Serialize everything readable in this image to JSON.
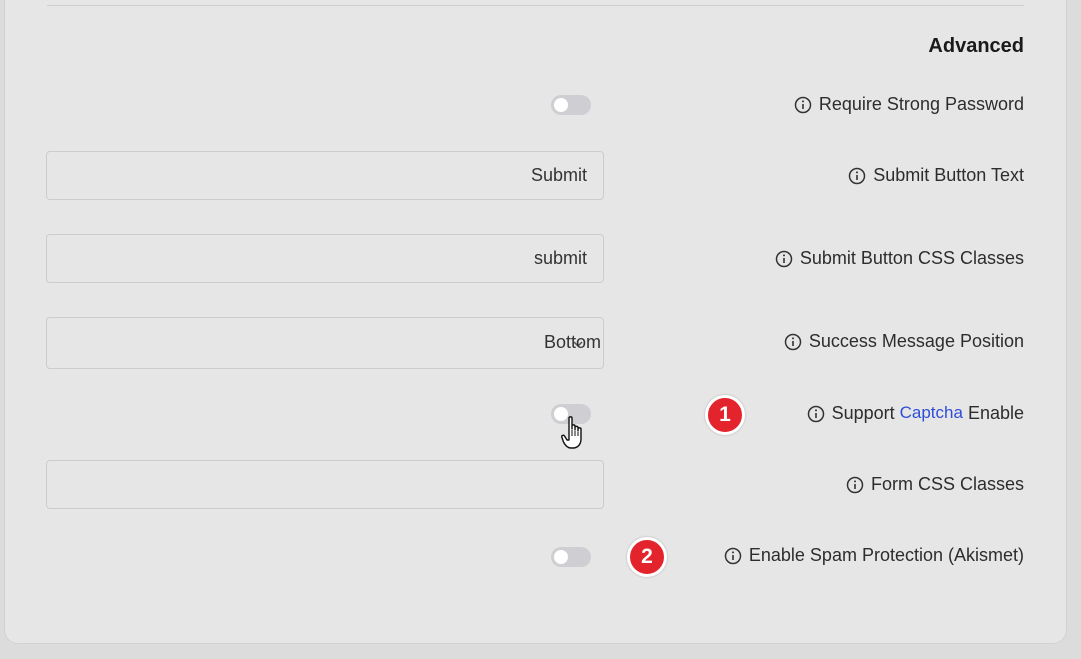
{
  "section": {
    "title": "Advanced"
  },
  "rows": {
    "strong_password": {
      "label": "Require Strong Password",
      "enabled": false
    },
    "submit_text": {
      "label": "Submit Button Text",
      "value": "Submit",
      "placeholder": ""
    },
    "submit_classes": {
      "label": "Submit Button CSS Classes",
      "value": "submit",
      "placeholder": ""
    },
    "success_position": {
      "label": "Success Message Position",
      "value": "Bottom"
    },
    "captcha": {
      "label_before": "Support",
      "link": "Captcha",
      "label_after": "Enable",
      "enabled": false
    },
    "form_classes": {
      "label": "Form CSS Classes",
      "value": "",
      "placeholder": ""
    },
    "spam": {
      "label": "Enable Spam Protection (Akismet)",
      "enabled": false
    }
  },
  "badges": {
    "one": "1",
    "two": "2"
  },
  "colors": {
    "panel_bg": "#e6e6e6",
    "toggle_off": "#cfcfd3",
    "link": "#2f4ed8",
    "badge": "#e4242c"
  },
  "icons": {
    "info": "info-circle-icon",
    "chevron": "chevron-down-icon",
    "cursor": "hand-pointer-cursor-icon"
  }
}
